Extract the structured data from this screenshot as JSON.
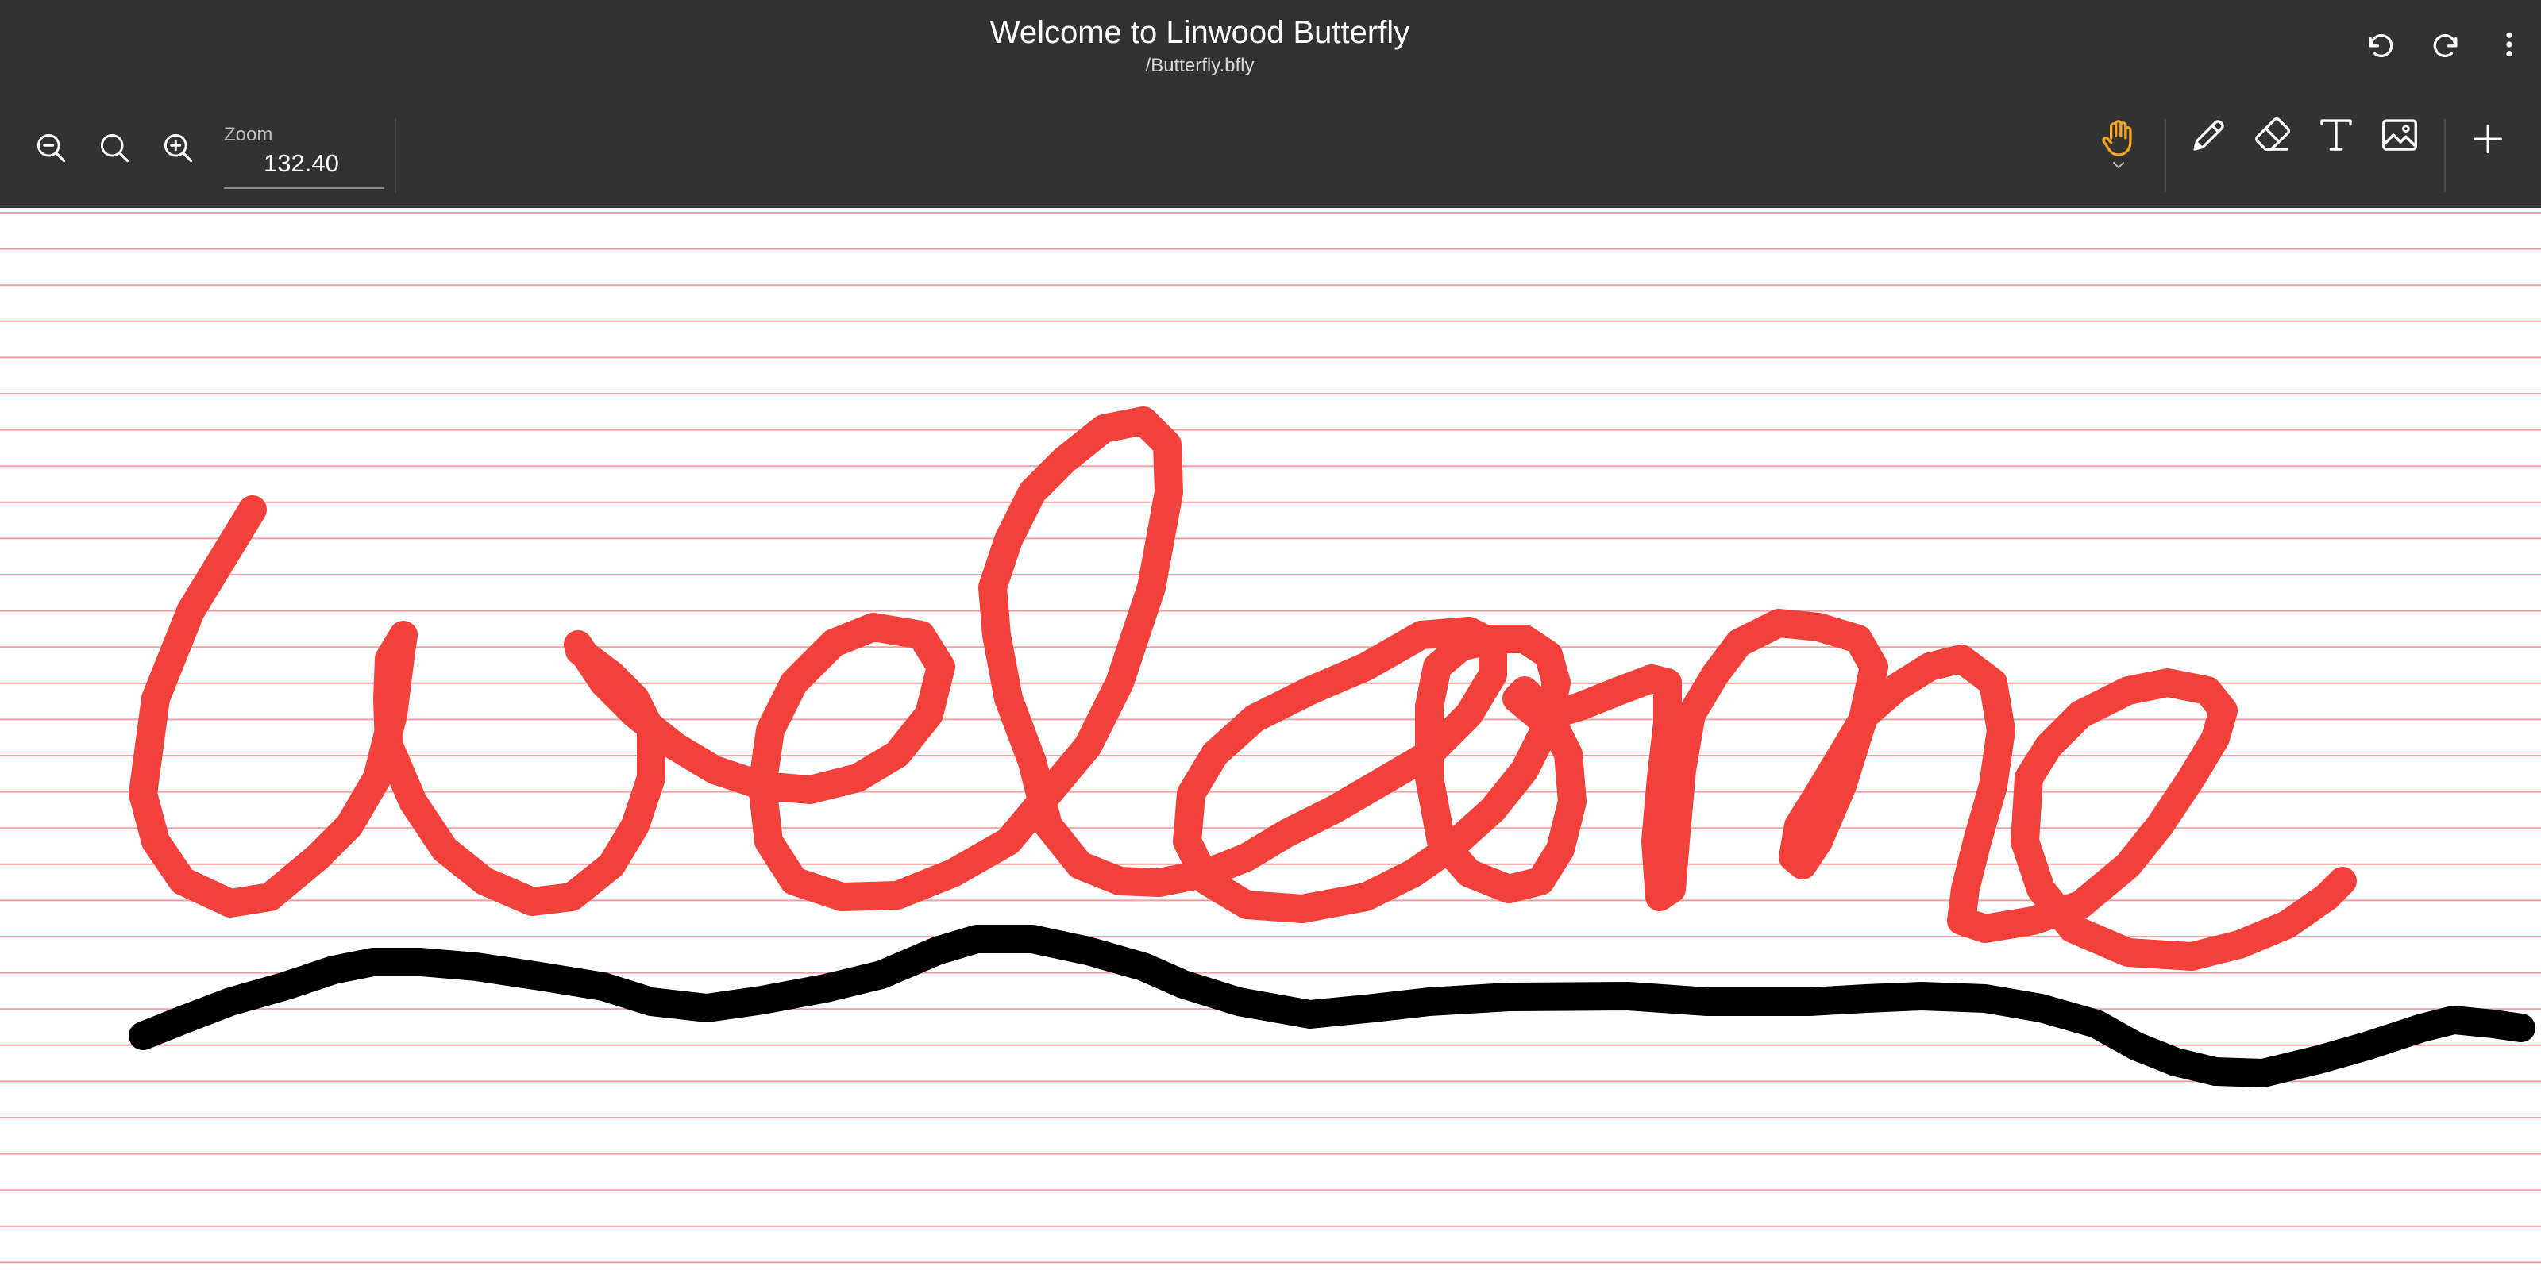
{
  "window": {
    "title": "Welcome to Linwood Butterfly",
    "path": "/Butterfly.bfly"
  },
  "header_actions": [
    {
      "name": "undo-icon",
      "label": "Undo"
    },
    {
      "name": "redo-icon",
      "label": "Redo"
    },
    {
      "name": "more-vert-icon",
      "label": "More"
    }
  ],
  "zoom": {
    "label": "Zoom",
    "value": "132.40"
  },
  "zoom_controls": [
    {
      "name": "zoom-out-icon"
    },
    {
      "name": "zoom-reset-icon"
    },
    {
      "name": "zoom-in-icon"
    }
  ],
  "tools": [
    {
      "name": "hand-icon",
      "selected": true
    },
    {
      "name": "pen-icon",
      "selected": false
    },
    {
      "name": "eraser-icon",
      "selected": false
    },
    {
      "name": "text-icon",
      "selected": false
    },
    {
      "name": "image-icon",
      "selected": false
    },
    {
      "name": "add-icon",
      "selected": false
    }
  ],
  "colors": {
    "toolbar": "#323232",
    "accent": "#f5a623",
    "ruled_lines": "#f0a0a0",
    "ink_red": "#f2403a",
    "ink_black": "#000000"
  },
  "canvas": {
    "background": "ruled",
    "strokes": [
      {
        "color": "#f2403a",
        "description": "handwritten word"
      },
      {
        "color": "#000000",
        "description": "underline wave"
      }
    ]
  }
}
